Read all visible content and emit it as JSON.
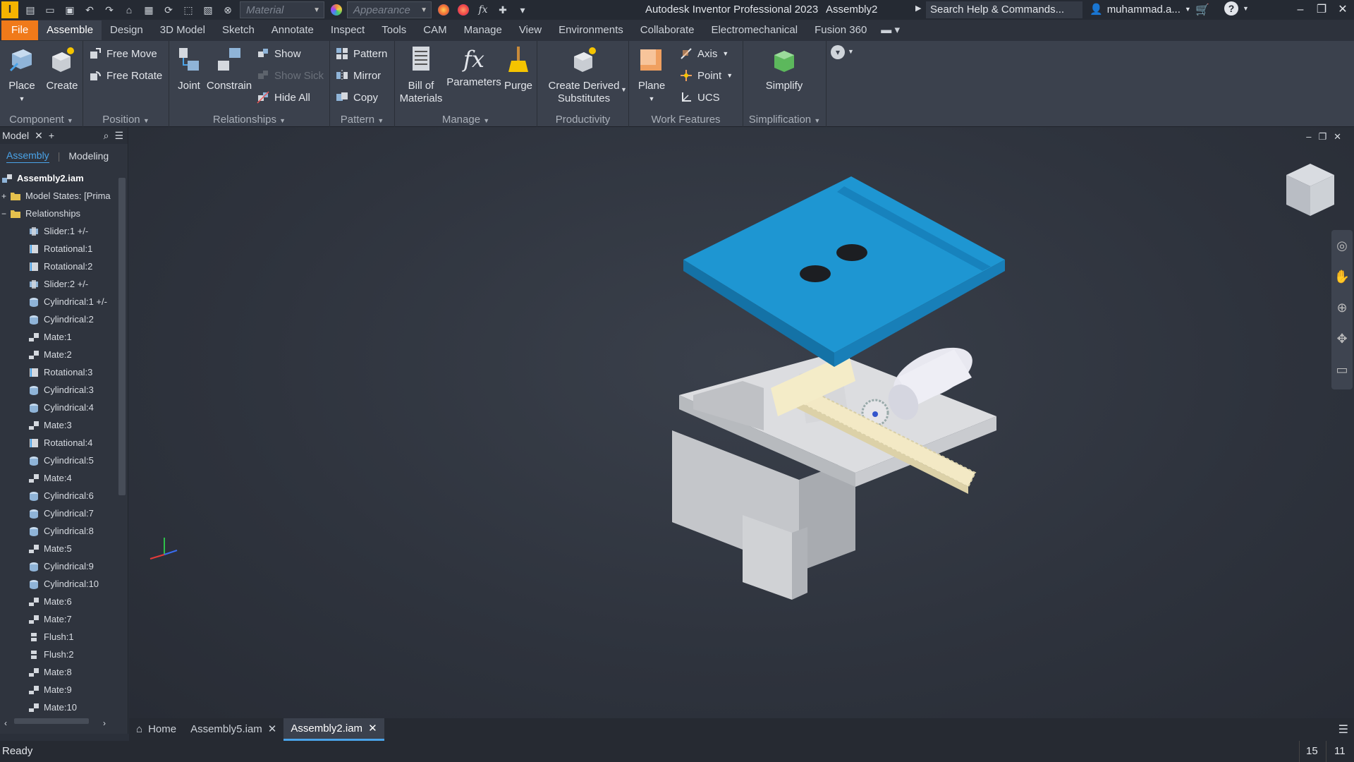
{
  "titlebar": {
    "app_letter": "I",
    "material_placeholder": "Material",
    "appearance_placeholder": "Appearance",
    "app_title": "Autodesk Inventor Professional 2023",
    "document": "Assembly2",
    "search": "Search Help & Commands...",
    "user": "muhammad.a..."
  },
  "menu": [
    "File",
    "Assemble",
    "Design",
    "3D Model",
    "Sketch",
    "Annotate",
    "Inspect",
    "Tools",
    "CAM",
    "Manage",
    "View",
    "Environments",
    "Collaborate",
    "Electromechanical",
    "Fusion 360"
  ],
  "ribbon": {
    "component": {
      "label": "Component",
      "place": "Place",
      "create": "Create"
    },
    "position": {
      "label": "Position",
      "free_move": "Free Move",
      "free_rotate": "Free Rotate"
    },
    "relationships": {
      "label": "Relationships",
      "joint": "Joint",
      "constrain": "Constrain",
      "show": "Show",
      "show_sick": "Show Sick",
      "hide_all": "Hide All"
    },
    "pattern": {
      "label": "Pattern",
      "pattern": "Pattern",
      "mirror": "Mirror",
      "copy": "Copy"
    },
    "manage": {
      "label": "Manage",
      "bom_1": "Bill of",
      "bom_2": "Materials",
      "parameters": "Parameters",
      "purge": "Purge"
    },
    "productivity": {
      "label": "Productivity",
      "derived_1": "Create Derived",
      "derived_2": "Substitutes"
    },
    "work_features": {
      "label": "Work Features",
      "plane": "Plane",
      "axis": "Axis",
      "point": "Point",
      "ucs": "UCS"
    },
    "simplification": {
      "label": "Simplification",
      "simplify": "Simplify"
    }
  },
  "browser": {
    "tab": "Model",
    "subtab_assembly": "Assembly",
    "subtab_modeling": "Modeling",
    "root": "Assembly2.iam",
    "model_states": "Model States: [Prima",
    "relationships": "Relationships",
    "items": [
      "Slider:1 +/-",
      "Rotational:1",
      "Rotational:2",
      "Slider:2 +/-",
      "Cylindrical:1 +/-",
      "Cylindrical:2",
      "Mate:1",
      "Mate:2",
      "Rotational:3",
      "Cylindrical:3",
      "Cylindrical:4",
      "Mate:3",
      "Rotational:4",
      "Cylindrical:5",
      "Mate:4",
      "Cylindrical:6",
      "Cylindrical:7",
      "Cylindrical:8",
      "Mate:5",
      "Cylindrical:9",
      "Cylindrical:10",
      "Mate:6",
      "Mate:7",
      "Flush:1",
      "Flush:2",
      "Mate:8",
      "Mate:9",
      "Mate:10"
    ],
    "item_kinds": [
      "slider",
      "rotational",
      "rotational",
      "slider",
      "cylindrical",
      "cylindrical",
      "mate",
      "mate",
      "rotational",
      "cylindrical",
      "cylindrical",
      "mate",
      "rotational",
      "cylindrical",
      "mate",
      "cylindrical",
      "cylindrical",
      "cylindrical",
      "mate",
      "cylindrical",
      "cylindrical",
      "mate",
      "mate",
      "flush",
      "flush",
      "mate",
      "mate",
      "mate"
    ]
  },
  "doc_tabs": {
    "home": "Home",
    "tab1": "Assembly5.iam",
    "tab2": "Assembly2.iam"
  },
  "status": {
    "text": "Ready",
    "count1": "15",
    "count2": "11"
  },
  "colors": {
    "accent": "#4aa3e8",
    "file_tab": "#f07a1a",
    "plate_blue": "#1e96d2"
  }
}
